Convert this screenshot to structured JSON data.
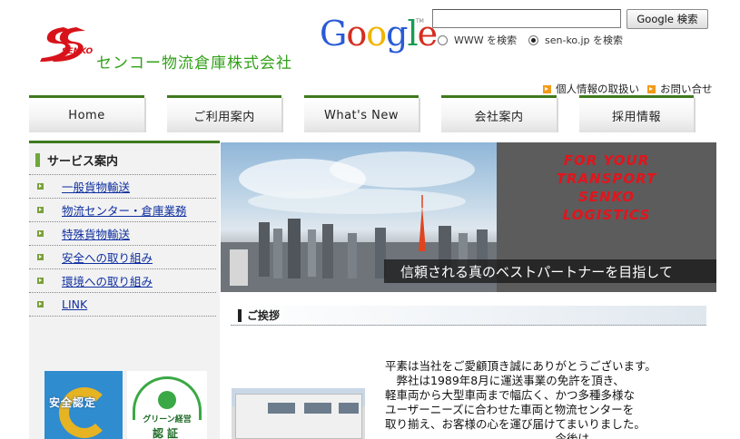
{
  "header": {
    "logo_word": "SENKO",
    "company_name": "センコー物流倉庫株式会社",
    "google_letters": [
      {
        "ch": "G",
        "color": "#2a5bd7"
      },
      {
        "ch": "o",
        "color": "#d62d20"
      },
      {
        "ch": "o",
        "color": "#f2b400"
      },
      {
        "ch": "g",
        "color": "#2a5bd7"
      },
      {
        "ch": "l",
        "color": "#179c52"
      },
      {
        "ch": "e",
        "color": "#d62d20"
      }
    ],
    "google_tm": "TM"
  },
  "search": {
    "value": "",
    "placeholder": "",
    "button_label": "Google 検索",
    "option_www": "WWW を検索",
    "option_site": "sen-ko.jp を検索",
    "selected": "site"
  },
  "top_links": {
    "privacy": "個人情報の取扱い",
    "contact": "お問い合せ"
  },
  "nav": {
    "home": "Home",
    "guide": "ご利用案内",
    "whats_new": "What's New",
    "company": "会社案内",
    "recruit": "採用情報"
  },
  "sidebar": {
    "title": "サービス案内",
    "items": [
      {
        "label": "一般貨物輸送"
      },
      {
        "label": "物流センター・倉庫業務"
      },
      {
        "label": "特殊貨物輸送"
      },
      {
        "label": "安全への取り組み"
      },
      {
        "label": "環境への取り組み"
      },
      {
        "label": "LINK"
      }
    ],
    "badge_safety": "安全認定",
    "badge_green_top": "グリーン経営",
    "badge_green_bottom": "認証"
  },
  "hero": {
    "tagline": [
      "FOR  YOUR",
      "TRANSPORT",
      "SENKO",
      "LOGISTICS"
    ],
    "slogan": "信頼される真のベストパートナーを目指して"
  },
  "greeting": {
    "title": "ご挨拶",
    "lines": [
      "平素は当社をご愛顧頂き誠にありがとうございます。",
      "　弊社は1989年8月に運送事業の免許を頂き、",
      "軽車両から大型車両まで幅広く、かつ多種多様な",
      "ユーザーニーズに合わせた車両と物流センターを",
      "取り揃え、お客様の心を運び届けてまいりました。",
      "　　　　　　　　　　　　　　　今後は"
    ]
  },
  "colors": {
    "brand_green": "#33a11a",
    "nav_border": "#3f7a1e",
    "logo_red": "#d8121a",
    "tagline_red": "#e3141c",
    "link_blue": "#1030a0"
  }
}
